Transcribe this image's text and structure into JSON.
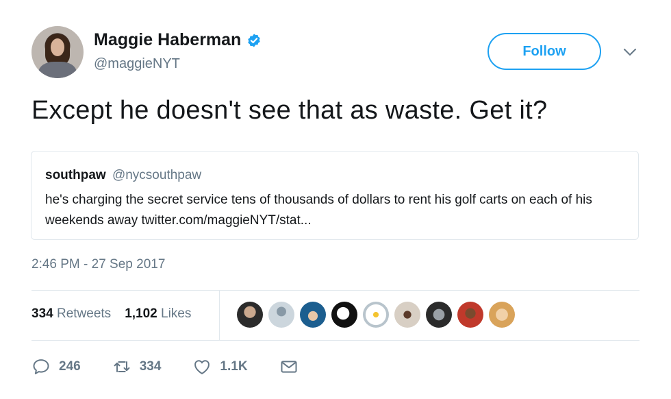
{
  "author": {
    "name": "Maggie Haberman",
    "handle": "@maggieNYT"
  },
  "follow_label": "Follow",
  "tweet_text": "Except he doesn't see that as waste. Get it?",
  "quote": {
    "name": "southpaw",
    "handle": "@nycsouthpaw",
    "text": "he's charging the secret service tens of thousands of dollars to rent his golf carts on each of his weekends away twitter.com/maggieNYT/stat..."
  },
  "timestamp": "2:46 PM - 27 Sep 2017",
  "stats": {
    "retweets_count": "334",
    "retweets_label": "Retweets",
    "likes_count": "1,102",
    "likes_label": "Likes"
  },
  "actions": {
    "reply_count": "246",
    "retweet_count": "334",
    "like_count": "1.1K"
  },
  "colors": {
    "accent": "#1da1f2",
    "muted": "#657786",
    "border": "#e1e8ed"
  }
}
